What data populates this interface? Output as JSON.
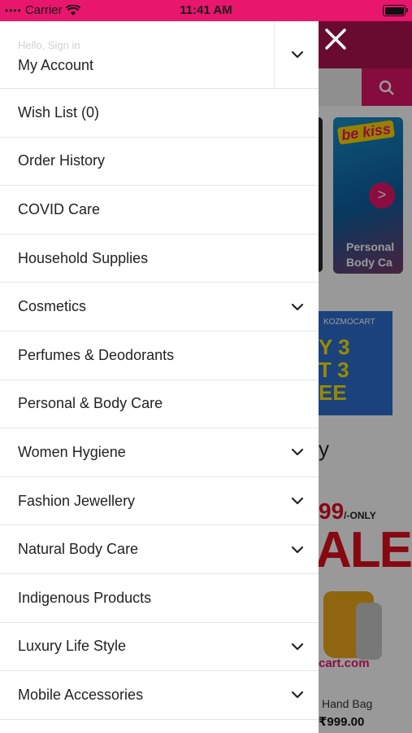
{
  "status_bar": {
    "carrier": "Carrier",
    "time": "11:41 AM"
  },
  "drawer": {
    "account": {
      "greeting": "Hello, Sign in",
      "title": "My Account"
    },
    "items": [
      {
        "label": "Wish List (0)",
        "has_submenu": false
      },
      {
        "label": "Order History",
        "has_submenu": false
      },
      {
        "label": "COVID Care",
        "has_submenu": false
      },
      {
        "label": "Household Supplies",
        "has_submenu": false
      },
      {
        "label": "Cosmetics",
        "has_submenu": true
      },
      {
        "label": "Perfumes & Deodorants",
        "has_submenu": false
      },
      {
        "label": "Personal & Body Care",
        "has_submenu": false
      },
      {
        "label": "Women Hygiene",
        "has_submenu": true
      },
      {
        "label": "Fashion Jewellery",
        "has_submenu": true
      },
      {
        "label": "Natural Body Care",
        "has_submenu": true
      },
      {
        "label": "Indigenous Products",
        "has_submenu": false
      },
      {
        "label": "Luxury Life Style",
        "has_submenu": true
      },
      {
        "label": "Mobile Accessories",
        "has_submenu": true
      }
    ]
  },
  "background": {
    "card_kiss": "be kiss",
    "card_category_line1": "Personal",
    "card_category_line2": "Body Ca",
    "arrow": ">",
    "banner_brand": "KOZMOCART",
    "banner_line1": "Y 3",
    "banner_line2": "T 3",
    "banner_line3": "EE",
    "heading_fragment": "y",
    "price_offer": "99",
    "price_offer_suffix": "/-ONLY",
    "sale": "ALE",
    "site": "cart.com",
    "item_name": "Hand Bag",
    "item_price": "₹999.00"
  },
  "colors": {
    "brand": "#e8166c",
    "header_dark": "#b01252"
  },
  "icons": {
    "close": "close-icon",
    "search": "search-icon",
    "chevron": "chevron-down-icon",
    "wifi": "wifi-icon",
    "battery": "battery-icon"
  }
}
